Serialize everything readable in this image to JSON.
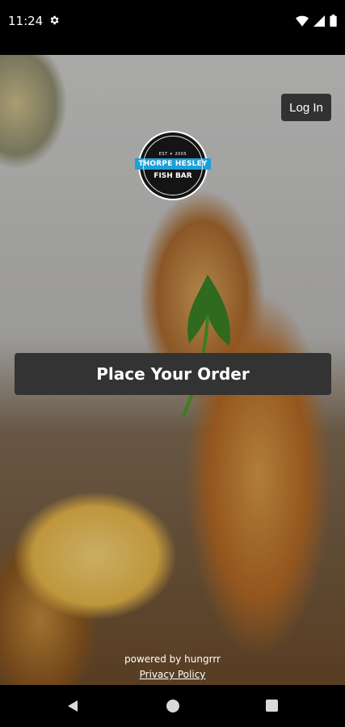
{
  "status_bar": {
    "time": "11:24"
  },
  "logo": {
    "est": "EST ✦ 2005",
    "name_line1": "THORPE HESLEY",
    "name_line2": "FISH BAR"
  },
  "header": {
    "login_label": "Log In"
  },
  "main": {
    "order_label": "Place Your Order"
  },
  "footer": {
    "powered_by": "powered by hungrrr",
    "privacy_label": "Privacy Policy"
  },
  "colors": {
    "logo_band": "#1d9fd8",
    "button_bg": "#333333"
  }
}
